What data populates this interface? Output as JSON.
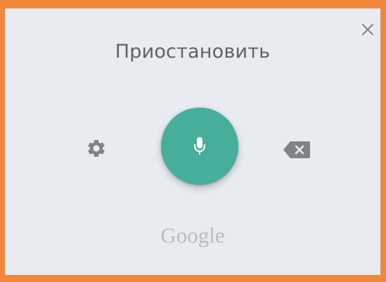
{
  "panel": {
    "status_label": "Приостановить",
    "logo_text": "Google"
  },
  "icons": {
    "close": "close-icon",
    "settings": "gear-icon",
    "microphone": "microphone-icon",
    "backspace": "backspace-icon"
  },
  "colors": {
    "frame": "#f1873a",
    "panel_background": "#e8ebef",
    "mic_button": "#46ae9b",
    "icon_gray": "#7f8388",
    "label_text": "#5f6368",
    "logo_text": "#b9bdc1"
  }
}
